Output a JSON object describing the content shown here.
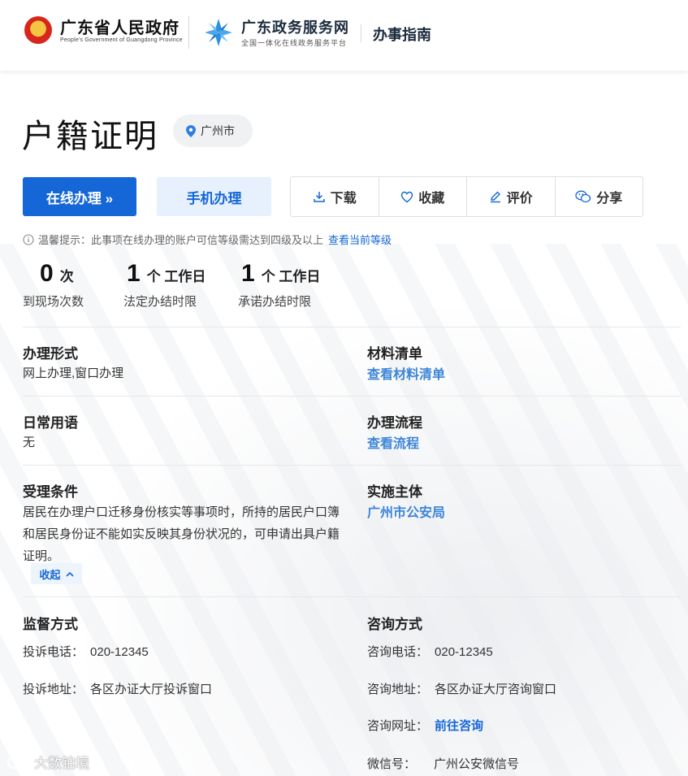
{
  "header": {
    "gov_name": "广东省人民政府",
    "gov_sub": "People's Government of Guangdong Province",
    "service_name": "广东政务服务网",
    "service_sub": "全国一体化在线政务服务平台",
    "guide": "办事指南"
  },
  "page": {
    "title": "户籍证明",
    "location": "广州市"
  },
  "buttons": {
    "online": "在线办理 »",
    "mobile": "手机办理",
    "download": "下载",
    "favorite": "收藏",
    "evaluate": "评价",
    "share": "分享"
  },
  "tip": {
    "text": "温馨提示：此事项在线办理的账户可信等级需达到四级及以上",
    "link": "查看当前等级"
  },
  "stats": [
    {
      "num": "0",
      "unit": "次",
      "label": "到现场次数"
    },
    {
      "num": "1",
      "unit": "个 工作日",
      "label": "法定办结时限"
    },
    {
      "num": "1",
      "unit": "个 工作日",
      "label": "承诺办结时限"
    }
  ],
  "sections": {
    "form_title": "办理形式",
    "form_value": "网上办理,窗口办理",
    "materials_title": "材料清单",
    "materials_link": "查看材料清单",
    "phrases_title": "日常用语",
    "phrases_value": "无",
    "process_title": "办理流程",
    "process_link": "查看流程",
    "conditions_title": "受理条件",
    "conditions_text": "居民在办理户口迁移身份核实等事项时，所持的居民户口簿和居民身份证不能如实反映其身份状况的，可申请出具户籍证明。",
    "collapse_label": "收起",
    "entity_title": "实施主体",
    "entity_link": "广州市公安局",
    "supervise_title": "监督方式",
    "supervise_phone_k": "投诉电话：",
    "supervise_phone_v": "020-12345",
    "supervise_addr_k": "投诉地址：",
    "supervise_addr_v": "各区办证大厅投诉窗口",
    "consult_title": "咨询方式",
    "consult_phone_k": "咨询电话：",
    "consult_phone_v": "020-12345",
    "consult_addr_k": "咨询地址：",
    "consult_addr_v": "各区办证大厅咨询窗口",
    "consult_web_k": "咨询网址：",
    "consult_web_v": "前往咨询",
    "consult_wechat_k": "微信号：",
    "consult_wechat_v": "广州公安微信号"
  },
  "watermark": "大数铂境",
  "colors": {
    "primary": "#1566d6",
    "link": "#3d85d8",
    "light_blue": "#e6f1fd"
  }
}
